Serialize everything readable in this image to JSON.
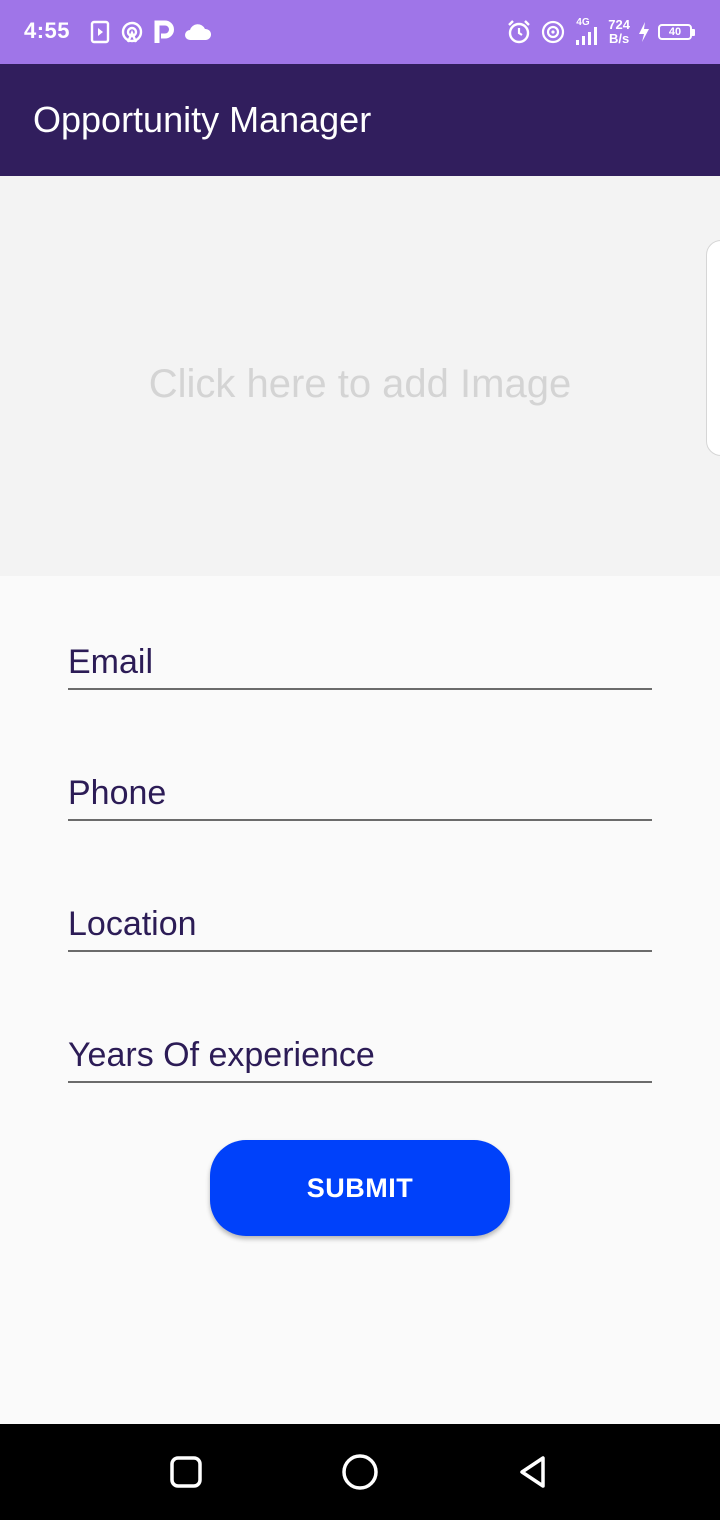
{
  "status_bar": {
    "time": "4:55",
    "network_speed_value": "724",
    "network_speed_unit": "B/s",
    "network_type": "4G",
    "battery_level": "40",
    "left_icons": [
      "screen-record-icon",
      "hotspot-icon",
      "parking-app-icon",
      "cloud-icon"
    ],
    "right_icons": [
      "alarm-icon",
      "hotspot-icon",
      "cellular-signal-icon",
      "charging-bolt-icon",
      "battery-icon"
    ],
    "background_color": "#9f75e8"
  },
  "app_bar": {
    "title": "Opportunity Manager",
    "background_color": "#311e5d"
  },
  "image_picker": {
    "label": "Click here to add Image"
  },
  "form": {
    "email": {
      "placeholder": "Email",
      "value": ""
    },
    "phone": {
      "placeholder": "Phone",
      "value": ""
    },
    "location": {
      "placeholder": "Location",
      "value": ""
    },
    "years": {
      "placeholder": "Years Of experience",
      "value": ""
    }
  },
  "submit": {
    "label": "SUBMIT",
    "color": "#0041fa"
  },
  "nav_bar": {
    "recents_icon": "square-recents-icon",
    "home_icon": "circle-home-icon",
    "back_icon": "triangle-back-icon"
  }
}
